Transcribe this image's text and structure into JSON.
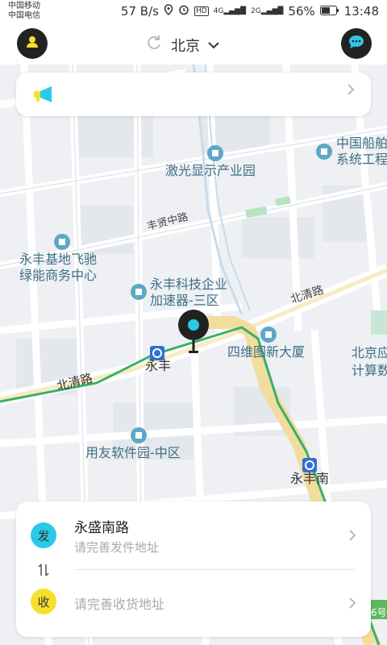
{
  "status_bar": {
    "carrier_1": "中国移动",
    "carrier_2": "中国电信",
    "net_speed": "57 B/s",
    "signal_1": "4G",
    "signal_2": "2G",
    "battery": "56%",
    "time": "13:48"
  },
  "header": {
    "city": "北京",
    "profile_icon": "user-icon",
    "message_icon": "chat-bubble-icon"
  },
  "notice": {
    "icon": "megaphone-icon",
    "text": ""
  },
  "map": {
    "roads": {
      "fengxian_road": "丰贤中路",
      "beiqing_road_east": "北清路",
      "beiqing_road_west": "北清路"
    },
    "pois": {
      "laser_park": "激光显示产业园",
      "china_ship_1": "中国船舶",
      "china_ship_2": "系统工程",
      "yongfeng_base_1": "永丰基地飞驰",
      "yongfeng_base_2": "绿能商务中心",
      "yongfeng_tech_1": "永丰科技企业",
      "yongfeng_tech_2": "加速器-三区",
      "siwei": "四维图新大厦",
      "beijing_app_1": "北京应",
      "beijing_app_2": "计算数",
      "yongyou": "用友软件园-中区",
      "line6": "6号"
    },
    "stations": {
      "yongfeng": "永丰",
      "yongfeng_south": "永丰南"
    }
  },
  "address_card": {
    "send_badge": "发",
    "send_title": "永盛南路",
    "send_hint": "请完善发件地址",
    "swap_icon": "swap-vertical-icon",
    "receive_badge": "收",
    "receive_hint": "请完善收货地址"
  },
  "colors": {
    "send_badge": "#2bc9e8",
    "receive_badge": "#f7e02b",
    "pin": "#2bc9e8"
  }
}
